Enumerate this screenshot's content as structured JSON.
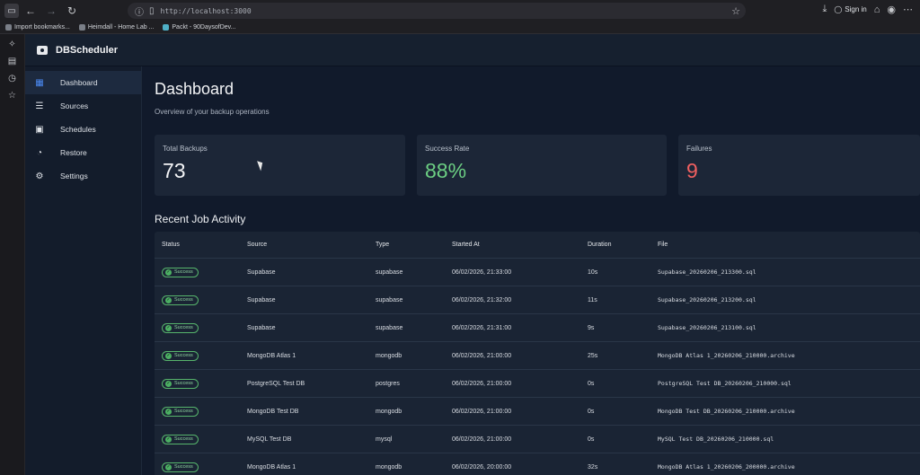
{
  "browser": {
    "url": "http://localhost:3000",
    "signin_label": "Sign in",
    "bookmarks": [
      "Import bookmarks...",
      "Heimdall - Home Lab ...",
      "Packt - 90DaysofDev..."
    ]
  },
  "app": {
    "title": "DBScheduler"
  },
  "sidebar": {
    "items": [
      {
        "label": "Dashboard",
        "icon": "dashboard-icon",
        "active": true
      },
      {
        "label": "Sources",
        "icon": "list-icon",
        "active": false
      },
      {
        "label": "Schedules",
        "icon": "calendar-icon",
        "active": false
      },
      {
        "label": "Restore",
        "icon": "history-icon",
        "active": false
      },
      {
        "label": "Settings",
        "icon": "gear-icon",
        "active": false
      }
    ]
  },
  "dashboard": {
    "title": "Dashboard",
    "subtitle": "Overview of your backup operations",
    "stats": [
      {
        "label": "Total Backups",
        "value": "73",
        "color": "#f3f4f6"
      },
      {
        "label": "Success Rate",
        "value": "88%",
        "color": "#6ccf83"
      },
      {
        "label": "Failures",
        "value": "9",
        "color": "#f06060"
      }
    ],
    "activity_title": "Recent Job Activity"
  },
  "table": {
    "headers": {
      "status": "Status",
      "source": "Source",
      "type": "Type",
      "started": "Started At",
      "duration": "Duration",
      "file": "File"
    },
    "rows": [
      {
        "status": "Success",
        "source": "Supabase",
        "type": "supabase",
        "started": "06/02/2026, 21:33:00",
        "duration": "10s",
        "file": "Supabase_20260206_213300.sql"
      },
      {
        "status": "Success",
        "source": "Supabase",
        "type": "supabase",
        "started": "06/02/2026, 21:32:00",
        "duration": "11s",
        "file": "Supabase_20260206_213200.sql"
      },
      {
        "status": "Success",
        "source": "Supabase",
        "type": "supabase",
        "started": "06/02/2026, 21:31:00",
        "duration": "9s",
        "file": "Supabase_20260206_213100.sql"
      },
      {
        "status": "Success",
        "source": "MongoDB Atlas 1",
        "type": "mongodb",
        "started": "06/02/2026, 21:00:00",
        "duration": "25s",
        "file": "MongoDB Atlas 1_20260206_210000.archive"
      },
      {
        "status": "Success",
        "source": "PostgreSQL Test DB",
        "type": "postgres",
        "started": "06/02/2026, 21:00:00",
        "duration": "0s",
        "file": "PostgreSQL Test DB_20260206_210000.sql"
      },
      {
        "status": "Success",
        "source": "MongoDB Test DB",
        "type": "mongodb",
        "started": "06/02/2026, 21:00:00",
        "duration": "0s",
        "file": "MongoDB Test DB_20260206_210000.archive"
      },
      {
        "status": "Success",
        "source": "MySQL Test DB",
        "type": "mysql",
        "started": "06/02/2026, 21:00:00",
        "duration": "0s",
        "file": "MySQL Test DB_20260206_210000.sql"
      },
      {
        "status": "Success",
        "source": "MongoDB Atlas 1",
        "type": "mongodb",
        "started": "06/02/2026, 20:00:00",
        "duration": "32s",
        "file": "MongoDB Atlas 1_20260206_200000.archive"
      }
    ]
  }
}
